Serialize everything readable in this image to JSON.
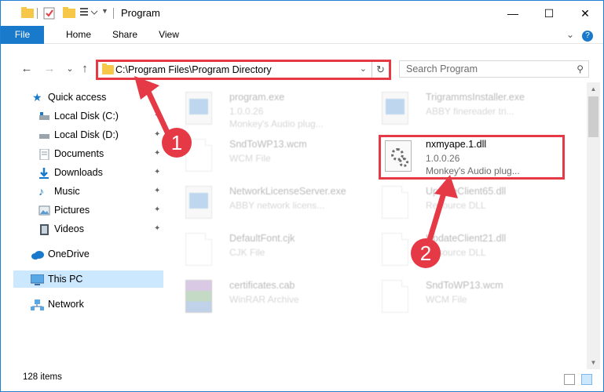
{
  "window": {
    "title": "Program",
    "minimize_glyph": "—",
    "maximize_glyph": "☐",
    "close_glyph": "✕"
  },
  "ribbon": {
    "tabs": [
      "File",
      "Home",
      "Share",
      "View"
    ],
    "help_glyph": "?",
    "collapse_glyph": "⌄"
  },
  "nav": {
    "back_glyph": "←",
    "forward_glyph": "→",
    "recent_glyph": "⌄",
    "up_glyph": "↑",
    "address": "C:\\Program Files\\Program Directory",
    "address_drop_glyph": "⌄",
    "refresh_glyph": "↻",
    "search_placeholder": "Search Program",
    "search_icon_glyph": "⚲"
  },
  "sidebar": {
    "items": [
      {
        "label": "Quick access",
        "icon": "star-icon"
      },
      {
        "label": "Local Disk (C:)",
        "icon": "drive-icon",
        "pinned": true
      },
      {
        "label": "Local Disk (D:)",
        "icon": "drive-icon",
        "pinned": true
      },
      {
        "label": "Documents",
        "icon": "documents-icon",
        "pinned": true
      },
      {
        "label": "Downloads",
        "icon": "download-icon",
        "pinned": true
      },
      {
        "label": "Music",
        "icon": "music-icon",
        "pinned": true
      },
      {
        "label": "Pictures",
        "icon": "pictures-icon",
        "pinned": true
      },
      {
        "label": "Videos",
        "icon": "videos-icon",
        "pinned": true
      },
      {
        "label": "OneDrive",
        "icon": "cloud-icon"
      },
      {
        "label": "This PC",
        "icon": "computer-icon",
        "selected": true
      },
      {
        "label": "Network",
        "icon": "network-icon"
      }
    ],
    "pin_glyph": "📌"
  },
  "files": [
    {
      "name": "program.exe",
      "meta1": "1.0.0.26",
      "meta2": "Monkey's Audio plug...",
      "icon": "exe-icon",
      "faded": true
    },
    {
      "name": "TrigrammsInstaller.exe",
      "meta1": "ABBY finereader tri...",
      "meta2": "",
      "icon": "exe-icon",
      "faded": true
    },
    {
      "name": "SndToWP13.wcm",
      "meta1": "WCM File",
      "meta2": "",
      "icon": "document-icon",
      "faded": true
    },
    {
      "name": "nxmyape.1.dll",
      "meta1": "1.0.0.26",
      "meta2": "Monkey's Audio plug...",
      "icon": "dll-icon",
      "faded": false
    },
    {
      "name": "NetworkLicenseServer.exe",
      "meta1": "ABBY network licens...",
      "meta2": "",
      "icon": "exe-icon",
      "faded": true
    },
    {
      "name": "UpdateClient65.dll",
      "meta1": "Resource DLL",
      "meta2": "",
      "icon": "dll-icon",
      "faded": true
    },
    {
      "name": "DefaultFont.cjk",
      "meta1": "CJK File",
      "meta2": "",
      "icon": "document-icon",
      "faded": true
    },
    {
      "name": "UpdateClient21.dll",
      "meta1": "Resource DLL",
      "meta2": "",
      "icon": "dll-icon",
      "faded": true
    },
    {
      "name": "certificates.cab",
      "meta1": "WinRAR Archive",
      "meta2": "",
      "icon": "archive-icon",
      "faded": true
    },
    {
      "name": "SndToWP13.wcm",
      "meta1": "WCM File",
      "meta2": "",
      "icon": "document-icon",
      "faded": true
    }
  ],
  "annotations": [
    "1",
    "2"
  ],
  "status": {
    "count": "128 items"
  },
  "colors": {
    "accent": "#1979ca",
    "highlight": "#e63946",
    "selected": "#cce8ff"
  }
}
